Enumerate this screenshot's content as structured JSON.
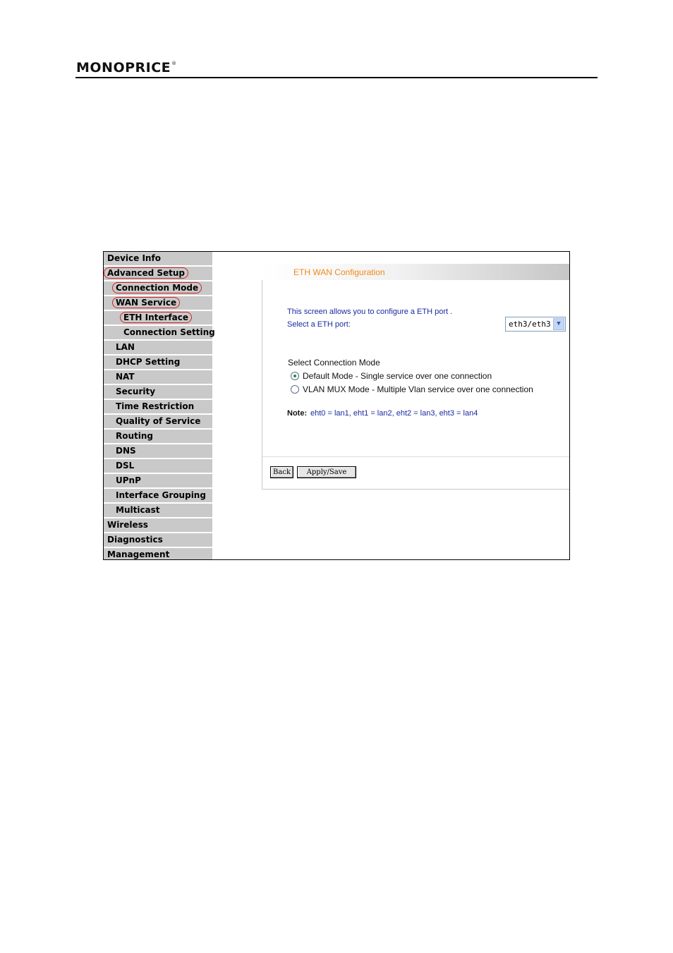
{
  "header": {
    "logo_text": "MONOPRICE",
    "logo_mark": "®"
  },
  "menu": [
    {
      "label": "Device Info",
      "level": 0,
      "highlighted": false
    },
    {
      "label": "Advanced Setup",
      "level": 0,
      "highlighted": true
    },
    {
      "label": "Connection Mode",
      "level": 1,
      "highlighted": true
    },
    {
      "label": "WAN Service",
      "level": 1,
      "highlighted": true
    },
    {
      "label": "ETH Interface",
      "level": 2,
      "highlighted": true
    },
    {
      "label": "Connection Setting",
      "level": 2,
      "highlighted": false
    },
    {
      "label": "LAN",
      "level": 1,
      "highlighted": false
    },
    {
      "label": "DHCP Setting",
      "level": 1,
      "highlighted": false
    },
    {
      "label": "NAT",
      "level": 1,
      "highlighted": false
    },
    {
      "label": "Security",
      "level": 1,
      "highlighted": false
    },
    {
      "label": "Time Restriction",
      "level": 1,
      "highlighted": false
    },
    {
      "label": "Quality of Service",
      "level": 1,
      "highlighted": false
    },
    {
      "label": "Routing",
      "level": 1,
      "highlighted": false
    },
    {
      "label": "DNS",
      "level": 1,
      "highlighted": false
    },
    {
      "label": "DSL",
      "level": 1,
      "highlighted": false
    },
    {
      "label": "UPnP",
      "level": 1,
      "highlighted": false
    },
    {
      "label": "Interface Grouping",
      "level": 1,
      "highlighted": false
    },
    {
      "label": "Multicast",
      "level": 1,
      "highlighted": false
    },
    {
      "label": "Wireless",
      "level": 0,
      "highlighted": false
    },
    {
      "label": "Diagnostics",
      "level": 0,
      "highlighted": false
    },
    {
      "label": "Management",
      "level": 0,
      "highlighted": false
    }
  ],
  "content": {
    "title": "ETH WAN Configuration",
    "intro": "This screen allows you to configure a ETH port .",
    "port_label": "Select a ETH port:",
    "port_value": "eth3/eth3",
    "mode_heading": "Select Connection Mode",
    "modes": [
      {
        "label": "Default Mode - Single service over one connection",
        "checked": true
      },
      {
        "label": "VLAN MUX Mode - Multiple Vlan service over one connection",
        "checked": false
      }
    ],
    "note_label": "Note:",
    "note_text": "eht0 = lan1, eht1 = lan2, eht2 = lan3, eht3 = lan4",
    "back_label": "Back",
    "apply_label": "Apply/Save"
  },
  "colors": {
    "title": "#f08a1c",
    "body_text": "#1a2aa0",
    "menu_bg": "#c9c9c9",
    "highlight_ring": "#d42020"
  },
  "icons": {
    "dropdown": "chevron-down-icon"
  }
}
